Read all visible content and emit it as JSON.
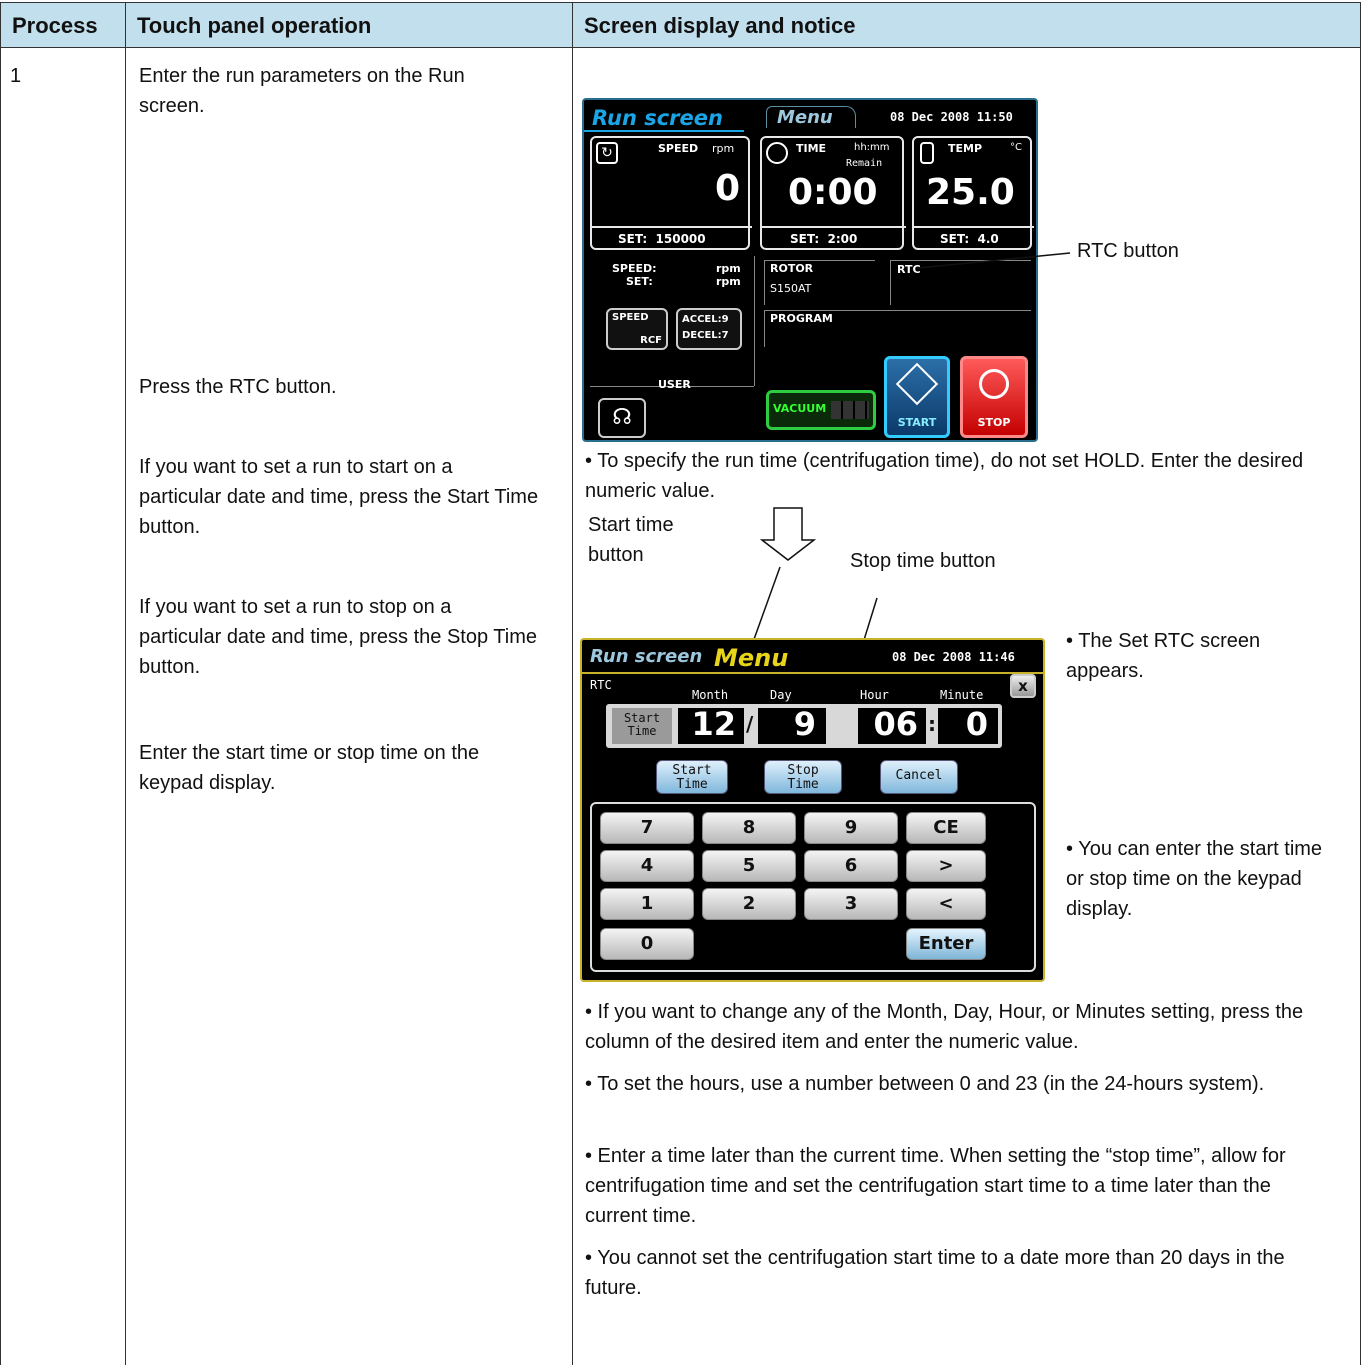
{
  "table": {
    "headers": [
      "Process",
      "Touch panel operation",
      "Screen display and notice"
    ],
    "step_number": "1",
    "operations": [
      "Enter the run parameters on the Run screen.",
      "Press the RTC button.",
      "If you want to set a run to start on a particular date and time, press the Start Time button.",
      "If you want to set a run to stop on a particular date and time, press the Stop Time button.",
      "Enter the start time or stop time on the keypad display."
    ]
  },
  "run_screen": {
    "tab_run": "Run screen",
    "tab_menu": "Menu",
    "datetime": "08 Dec 2008 11:50",
    "speed_label": "SPEED",
    "speed_unit": "rpm",
    "speed_value": "0",
    "speed_set": "SET:  150000",
    "time_label": "TIME",
    "time_unit": "hh:mm",
    "time_remain": "Remain",
    "time_value": "0:00",
    "time_set": "SET:  2:00",
    "temp_label": "TEMP",
    "temp_unit": "°C",
    "temp_value": "25.0",
    "temp_set": "SET:  4.0",
    "info_speed": "SPEED:",
    "info_set": "SET:",
    "info_unit1": "rpm",
    "info_unit2": "rpm",
    "rotor_label": "ROTOR",
    "rotor_value": "S150AT",
    "rtc_label": "RTC",
    "program_label": "PROGRAM",
    "speed_btn_top": "SPEED",
    "speed_btn_bottom": "RCF",
    "accel": "ACCEL:9",
    "decel": "DECEL:7",
    "user_label": "USER",
    "vacuum_label": "VACUUM",
    "start_label": "START",
    "stop_label": "STOP"
  },
  "callouts": {
    "rtc_button": "RTC button",
    "start_time_button": "Start time button",
    "stop_time_button": "Stop time button"
  },
  "notices": {
    "run_time": "• To specify the run time (centrifugation time), do not set HOLD. Enter the desired numeric value.",
    "set_rtc_appears": "• The Set RTC screen appears.",
    "keypad_enter": "• You can enter the start time or stop time on the keypad display.",
    "change_setting": "• If you want to change any of the Month, Day, Hour, or Minutes setting, press the column of the desired item and enter the numeric value.",
    "hours_range": "• To set the hours, use a number between 0 and 23 (in the 24-hours system).",
    "later_time": "• Enter a time later than the current time. When setting the “stop time”, allow for centrifugation time and set the centrifugation start time to a time later than the current time.",
    "twenty_days": "• You cannot set the centrifugation start time to a date more than 20 days in the future."
  },
  "rtc_screen": {
    "tab_run": "Run screen",
    "tab_menu": "Menu",
    "datetime": "08 Dec 2008 11:46",
    "title": "RTC",
    "col_month": "Month",
    "col_day": "Day",
    "col_hour": "Hour",
    "col_minute": "Minute",
    "mode_line1": "Start",
    "mode_line2": "Time",
    "month": "12",
    "day": "9",
    "hour": "06",
    "minute": "0",
    "sep_date": "/",
    "sep_time": ":",
    "close": "x",
    "btn_start_1": "Start",
    "btn_start_2": "Time",
    "btn_stop_1": "Stop",
    "btn_stop_2": "Time",
    "btn_cancel": "Cancel",
    "keys": [
      "7",
      "8",
      "9",
      "CE",
      "4",
      "5",
      "6",
      ">",
      "1",
      "2",
      "3",
      "<",
      "0",
      "Enter"
    ]
  }
}
